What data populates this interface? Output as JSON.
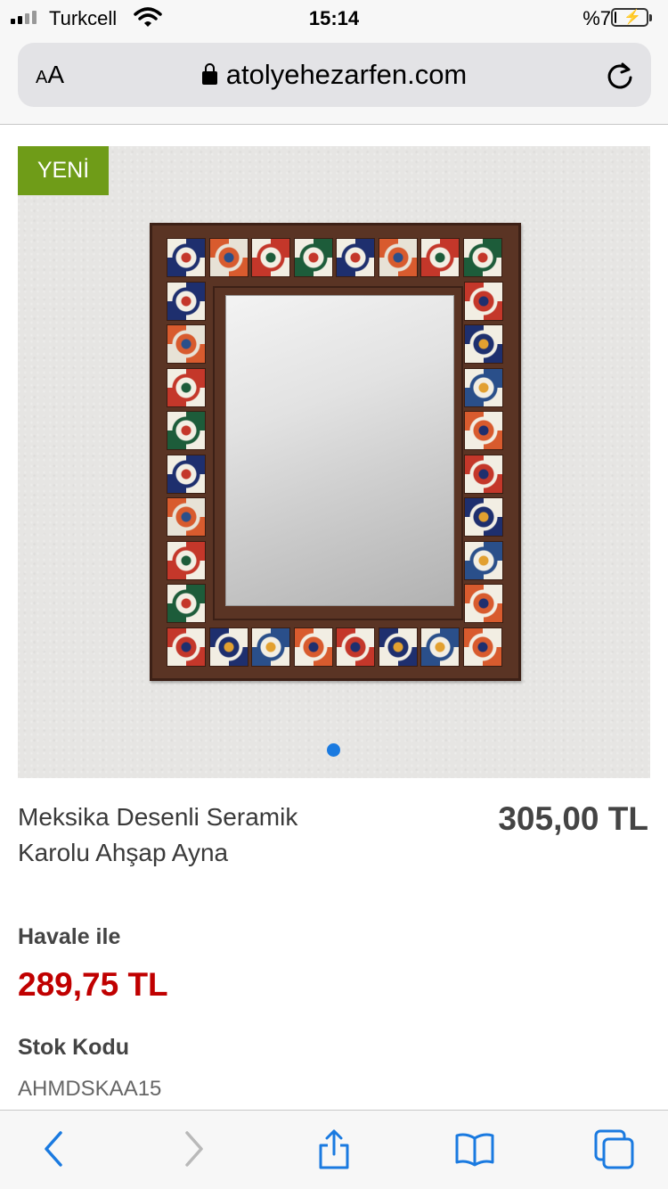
{
  "status_bar": {
    "carrier": "Turkcell",
    "time": "15:14",
    "battery_percent": "%7",
    "battery_level": 0.07
  },
  "browser": {
    "text_size_label_small": "A",
    "text_size_label_large": "A",
    "url": "atolyehezarfen.com"
  },
  "product": {
    "badge": "YENİ",
    "title": "Meksika Desenli Seramik Karolu Ahşap Ayna",
    "price": "305,00 TL",
    "transfer_label": "Havale ile",
    "transfer_price": "289,75 TL",
    "sku_label": "Stok Kodu",
    "sku_value": "AHMDSKAA15",
    "image_count": 1,
    "active_image": 1
  },
  "toolbar": {
    "icons": [
      "back-icon",
      "forward-icon",
      "share-icon",
      "bookmarks-icon",
      "tabs-icon"
    ],
    "accent_color": "#1a7ae0",
    "disabled_color": "#b9b9b9"
  },
  "colors": {
    "badge_green": "#6f9c18",
    "sale_red": "#c00000",
    "frame_wood": "#5a3424"
  }
}
